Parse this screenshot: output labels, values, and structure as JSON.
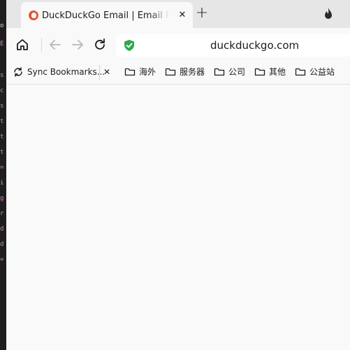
{
  "code_strip": {
    "lines": [
      {
        "text": "o",
        "color": "#d4d4d4"
      },
      {
        "text": "E",
        "color": "#c586c0"
      },
      {
        "text": "s",
        "color": "#c586c0"
      },
      {
        "text": "c",
        "color": "#c586c0"
      },
      {
        "text": "s",
        "color": "#c586c0"
      },
      {
        "text": "t",
        "color": "#c586c0"
      },
      {
        "text": "t",
        "color": "#c586c0"
      },
      {
        "text": "t",
        "color": "#c586c0"
      },
      {
        "text": "=",
        "color": "#c586c0"
      },
      {
        "text": "i",
        "color": "#c586c0"
      },
      {
        "text": "g",
        "color": "#c586c0"
      },
      {
        "text": "r",
        "color": "#c586c0"
      },
      {
        "text": "d",
        "color": "#c586c0"
      },
      {
        "text": "d",
        "color": "#c586c0"
      },
      {
        "text": "=",
        "color": "#c586c0"
      }
    ]
  },
  "tab": {
    "title": "DuckDuckGo Email | Email P",
    "close": "✕",
    "favicon": "duckduckgo-logo"
  },
  "toolbar": {
    "new_tab": "+",
    "fire_icon": "fire-icon",
    "home_icon": "home-icon",
    "back_icon": "arrow-left-icon",
    "forward_icon": "arrow-right-icon",
    "reload_icon": "reload-icon"
  },
  "address_bar": {
    "url": "duckduckgo.com",
    "shield_icon": "shield-check-icon",
    "shield_color": "#2fa84f"
  },
  "bookmarks": {
    "sync": "Sync Bookmarks...",
    "close": "✕",
    "folders": [
      "海外",
      "服务器",
      "公司",
      "其他",
      "公益站"
    ]
  },
  "colors": {
    "tabbar_bg": "#e7e6e6",
    "page_bg": "#f9f9f9",
    "editor_bg": "#1e1e1e",
    "accent_orange": "#de5833"
  }
}
